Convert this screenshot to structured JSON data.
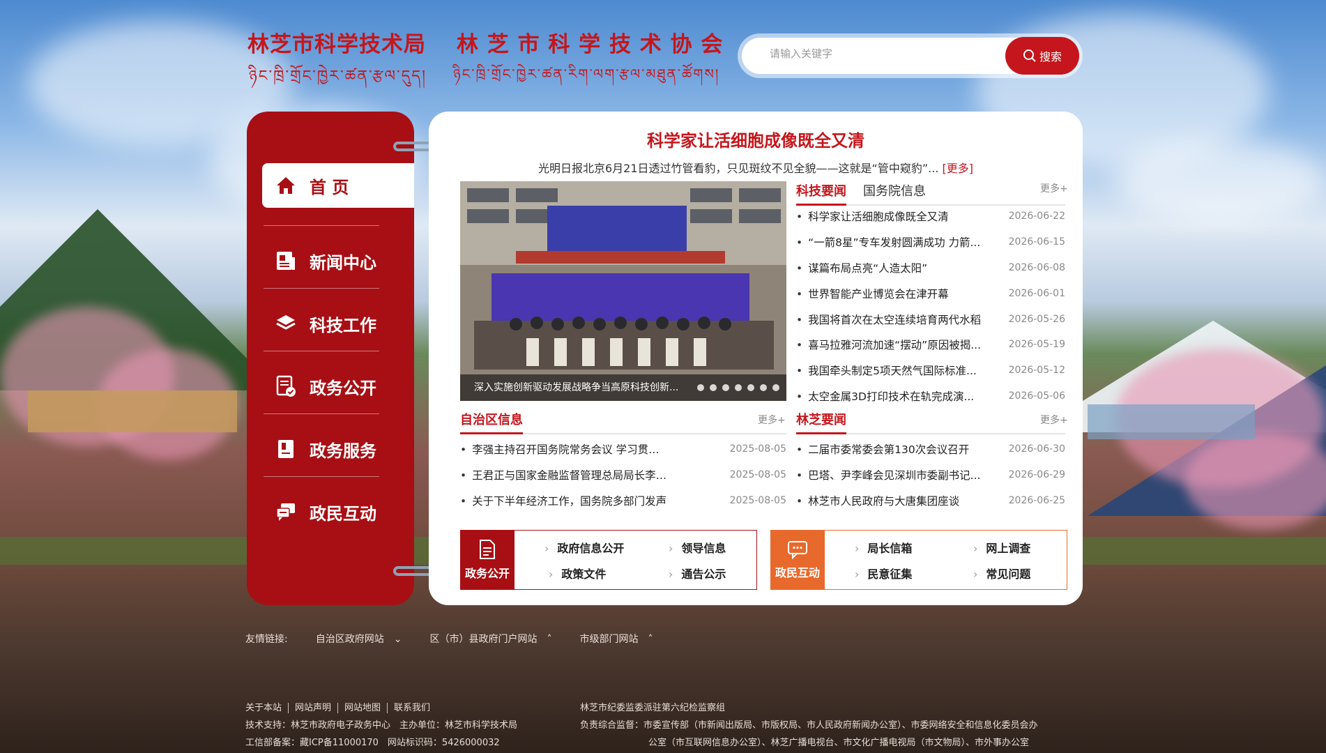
{
  "header": {
    "logo_cn_1": "林芝市科学技术局",
    "logo_tb_1": "ཉིང་ཁྲི་གྲོང་ཁྱེར་ཚན་རྩལ་དུད།",
    "logo_cn_2": "林 芝 市 科 学 技 术 协 会",
    "logo_tb_2": "ཉིང་ཁྲི་གྲོང་ཁྱེར་ཚན་རིག་ལག་རྩལ་མཐུན་ཚོགས།"
  },
  "search": {
    "placeholder": "请输入关键字",
    "button": "搜索"
  },
  "nav": [
    {
      "label": "首 页",
      "icon": "home-icon"
    },
    {
      "label": "新闻中心",
      "icon": "news-icon"
    },
    {
      "label": "科技工作",
      "icon": "layers-icon"
    },
    {
      "label": "政务公开",
      "icon": "document-check-icon"
    },
    {
      "label": "政务服务",
      "icon": "service-icon"
    },
    {
      "label": "政民互动",
      "icon": "chat-icon"
    }
  ],
  "headline": {
    "title": "科学家让活细胞成像既全又清",
    "summary": "光明日报北京6月21日透过竹管看豹，只见斑纹不见全貌——这就是“管中窥豹”...",
    "more": "[更多]"
  },
  "slider": {
    "caption": "深入实施创新驱动发展战略争当高原科技创新..."
  },
  "tech_news": {
    "tabs": [
      "科技要闻",
      "国务院信息"
    ],
    "more": "更多+",
    "items": [
      {
        "title": "科学家让活细胞成像既全又清",
        "date": "2026-06-22"
      },
      {
        "title": "“一箭8星”专车发射圆满成功 力箭...",
        "date": "2026-06-15"
      },
      {
        "title": "谋篇布局点亮“人造太阳”",
        "date": "2026-06-08"
      },
      {
        "title": "世界智能产业博览会在津开幕",
        "date": "2026-06-01"
      },
      {
        "title": "我国将首次在太空连续培育两代水稻",
        "date": "2026-05-26"
      },
      {
        "title": "喜马拉雅河流加速“摆动”原因被揭...",
        "date": "2026-05-19"
      },
      {
        "title": "我国牵头制定5项天然气国际标准...",
        "date": "2026-05-12"
      },
      {
        "title": "太空金属3D打印技术在轨完成演...",
        "date": "2026-05-06"
      }
    ]
  },
  "region_news": {
    "title": "自治区信息",
    "more": "更多+",
    "items": [
      {
        "title": "李强主持召开国务院常务会议 学习贯彻习...",
        "date": "2025-08-05"
      },
      {
        "title": "王君正与国家金融监督管理总局局长李云泽...",
        "date": "2025-08-05"
      },
      {
        "title": "关于下半年经济工作，国务院多部门发声",
        "date": "2025-08-05"
      }
    ]
  },
  "linzhi_news": {
    "title": "林芝要闻",
    "more": "更多+",
    "items": [
      {
        "title": "二届市委常委会第130次会议召开",
        "date": "2026-06-30"
      },
      {
        "title": "巴塔、尹李峰会见深圳市委副书记...",
        "date": "2026-06-29"
      },
      {
        "title": "林芝市人民政府与大唐集团座谈",
        "date": "2026-06-25"
      }
    ]
  },
  "quick_gov": {
    "label": "政务公开",
    "links": [
      "政府信息公开",
      "领导信息",
      "政策文件",
      "通告公示"
    ]
  },
  "quick_interact": {
    "label": "政民互动",
    "links": [
      "局长信箱",
      "网上调查",
      "民意征集",
      "常见问题"
    ]
  },
  "friends": {
    "label": "友情链接:",
    "options": [
      "自治区政府网站",
      "区（市）县政府门户网站",
      "市级部门网站"
    ]
  },
  "footer": {
    "links": [
      "关于本站",
      "网站声明",
      "网站地图",
      "联系我们"
    ],
    "support": "技术支持：林芝市政府电子政务中心　主办单位：林芝市科学技术局",
    "icp": "工信部备案：藏ICP备11000170　网站标识码：5426000032",
    "supervisor": "林芝市纪委监委派驻第六纪检监察组",
    "oversight_1": "负责综合监督：市委宣传部（市新闻出版局、市版权局、市人民政府新闻办公室）、市委网络安全和信息化委员会办",
    "oversight_2": "公室（市互联网信息办公室）、林芝广播电视台、市文化广播电视局（市文物局）、市外事办公室"
  },
  "colors": {
    "primary": "#c4161c",
    "sidebar": "#a70f14",
    "orange": "#e8692c"
  }
}
